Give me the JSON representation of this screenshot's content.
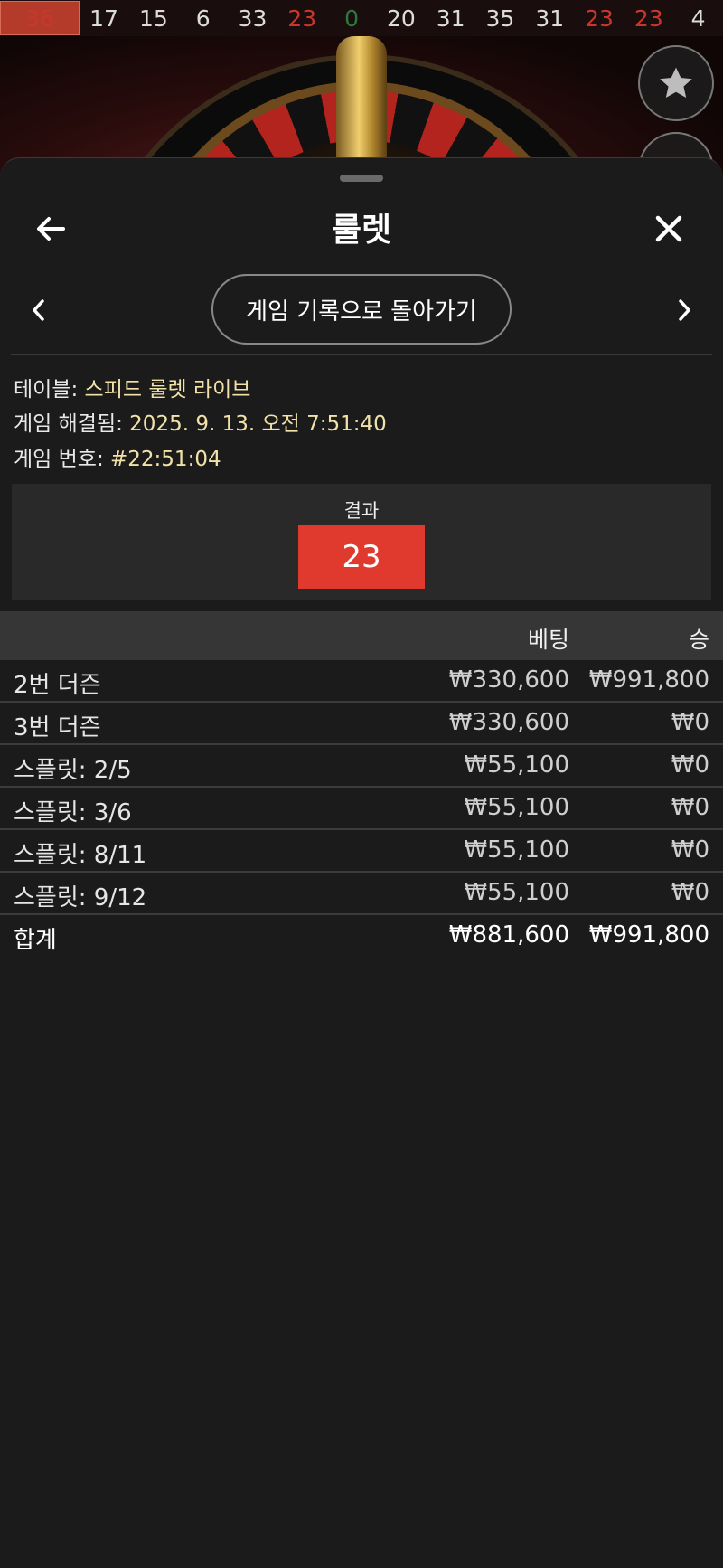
{
  "history": [
    {
      "n": "36",
      "color": "red",
      "highlight": true
    },
    {
      "n": "17",
      "color": "black"
    },
    {
      "n": "15",
      "color": "black"
    },
    {
      "n": "6",
      "color": "black"
    },
    {
      "n": "33",
      "color": "black"
    },
    {
      "n": "23",
      "color": "red"
    },
    {
      "n": "0",
      "color": "green"
    },
    {
      "n": "20",
      "color": "black"
    },
    {
      "n": "31",
      "color": "black"
    },
    {
      "n": "35",
      "color": "black"
    },
    {
      "n": "31",
      "color": "black"
    },
    {
      "n": "23",
      "color": "red"
    },
    {
      "n": "23",
      "color": "red"
    },
    {
      "n": "4",
      "color": "black"
    }
  ],
  "header": {
    "title": "룰렛"
  },
  "nav": {
    "back_to_history": "게임 기록으로 돌아가기"
  },
  "info": {
    "table_label": "테이블: ",
    "table_value": "스피드 룰렛 라이브",
    "resolved_label": "게임 해결됨: ",
    "resolved_value": "2025. 9. 13. 오전 7:51:40",
    "game_no_label": "게임 번호: ",
    "game_no_value": "#22:51:04"
  },
  "result": {
    "label": "결과",
    "number": "23",
    "color": "#e03a2e"
  },
  "table": {
    "col_bet": "베팅",
    "col_win": "승",
    "rows": [
      {
        "name": "2번 더즌",
        "bet": "₩330,600",
        "win": "₩991,800"
      },
      {
        "name": "3번 더즌",
        "bet": "₩330,600",
        "win": "₩0"
      },
      {
        "name": "스플릿: 2/5",
        "bet": "₩55,100",
        "win": "₩0"
      },
      {
        "name": "스플릿: 3/6",
        "bet": "₩55,100",
        "win": "₩0"
      },
      {
        "name": "스플릿: 8/11",
        "bet": "₩55,100",
        "win": "₩0"
      },
      {
        "name": "스플릿: 9/12",
        "bet": "₩55,100",
        "win": "₩0"
      }
    ],
    "total": {
      "name": "합계",
      "bet": "₩881,600",
      "win": "₩991,800"
    }
  },
  "icons": {
    "back": "arrow-left-icon",
    "close": "close-icon",
    "prev": "chevron-left-icon",
    "next": "chevron-right-icon",
    "favorite": "star-icon"
  }
}
